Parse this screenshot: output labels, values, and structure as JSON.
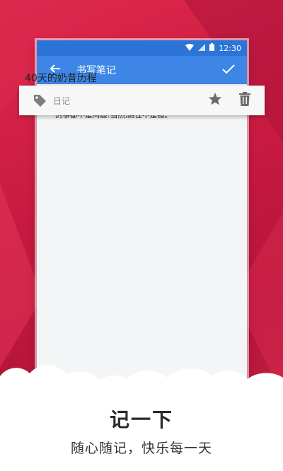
{
  "status_bar": {
    "time": "12:30"
  },
  "app_bar": {
    "title": "书写笔记"
  },
  "tag_bar": {
    "tag": "日记"
  },
  "note": {
    "title": "40天的奶昔历程",
    "body": "曾经,我是随性到死的家伙,只要吃饱、睡好,一切的事都不是问题!当然,随性不是错。"
  },
  "promo": {
    "headline": "记一下",
    "subheadline": "随心随记，快乐每一天"
  },
  "colors": {
    "background": "#c81a40",
    "status_bar": "#2c74d8",
    "app_bar": "#3d86e6",
    "content_background": "#f4f5f7"
  },
  "icons": [
    "wifi-icon",
    "signal-icon",
    "battery-icon",
    "back-arrow-icon",
    "check-icon",
    "tag-icon",
    "star-icon",
    "trash-icon"
  ]
}
